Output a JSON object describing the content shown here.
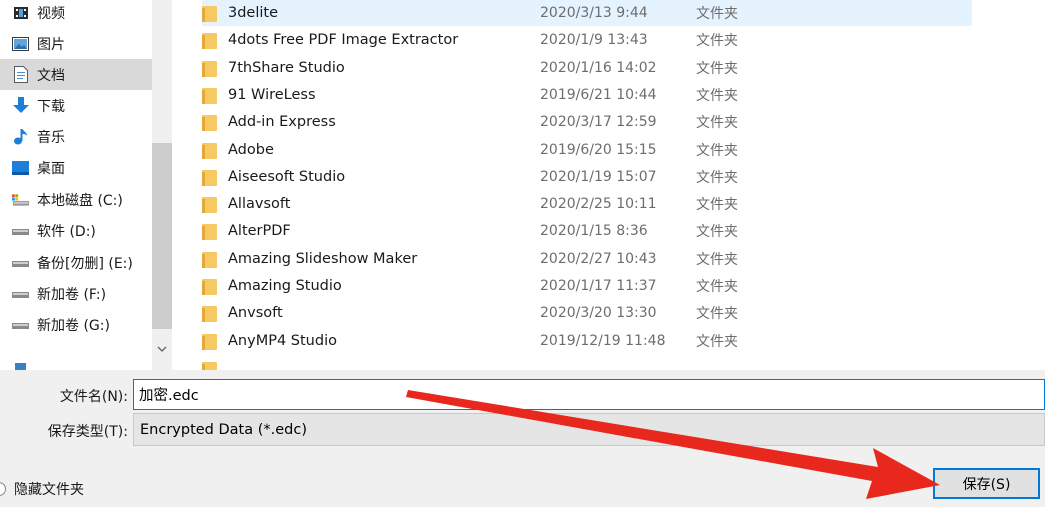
{
  "nav": {
    "items": [
      {
        "label": "视频",
        "icon": "video-icon"
      },
      {
        "label": "图片",
        "icon": "pictures-icon"
      },
      {
        "label": "文档",
        "icon": "documents-icon",
        "selected": true
      },
      {
        "label": "下载",
        "icon": "downloads-icon"
      },
      {
        "label": "音乐",
        "icon": "music-icon"
      },
      {
        "label": "桌面",
        "icon": "desktop-icon"
      },
      {
        "label": "本地磁盘 (C:)",
        "icon": "local-disk-icon"
      },
      {
        "label": "软件 (D:)",
        "icon": "drive-icon"
      },
      {
        "label": "备份[勿删] (E:)",
        "icon": "drive-icon"
      },
      {
        "label": "新加卷 (F:)",
        "icon": "drive-icon"
      },
      {
        "label": "新加卷 (G:)",
        "icon": "drive-icon"
      }
    ]
  },
  "files": [
    {
      "name": "3delite",
      "date": "2020/3/13 9:44",
      "type": "文件夹",
      "selected": true
    },
    {
      "name": "4dots Free PDF Image Extractor",
      "date": "2020/1/9 13:43",
      "type": "文件夹"
    },
    {
      "name": "7thShare Studio",
      "date": "2020/1/16 14:02",
      "type": "文件夹"
    },
    {
      "name": "91 WireLess",
      "date": "2019/6/21 10:44",
      "type": "文件夹"
    },
    {
      "name": "Add-in Express",
      "date": "2020/3/17 12:59",
      "type": "文件夹"
    },
    {
      "name": "Adobe",
      "date": "2019/6/20 15:15",
      "type": "文件夹"
    },
    {
      "name": "Aiseesoft Studio",
      "date": "2020/1/19 15:07",
      "type": "文件夹"
    },
    {
      "name": "Allavsoft",
      "date": "2020/2/25 10:11",
      "type": "文件夹"
    },
    {
      "name": "AlterPDF",
      "date": "2020/1/15 8:36",
      "type": "文件夹"
    },
    {
      "name": "Amazing Slideshow Maker",
      "date": "2020/2/27 10:43",
      "type": "文件夹"
    },
    {
      "name": "Amazing Studio",
      "date": "2020/1/17 11:37",
      "type": "文件夹"
    },
    {
      "name": "Anvsoft",
      "date": "2020/3/20 13:30",
      "type": "文件夹"
    },
    {
      "name": "AnyMP4 Studio",
      "date": "2019/12/19 11:48",
      "type": "文件夹"
    }
  ],
  "form": {
    "filename_label": "文件名(N):",
    "filename_value": "加密.edc",
    "filetype_label": "保存类型(T):",
    "filetype_value": "Encrypted Data (*.edc)"
  },
  "footer": {
    "hide_folders_label": "隐藏文件夹",
    "save_label": "保存(S)"
  },
  "colors": {
    "accent": "#0078d7",
    "annotation_arrow": "#e8281d",
    "selected_row": "#e5f3ff",
    "selected_nav": "#d9d9d9"
  }
}
